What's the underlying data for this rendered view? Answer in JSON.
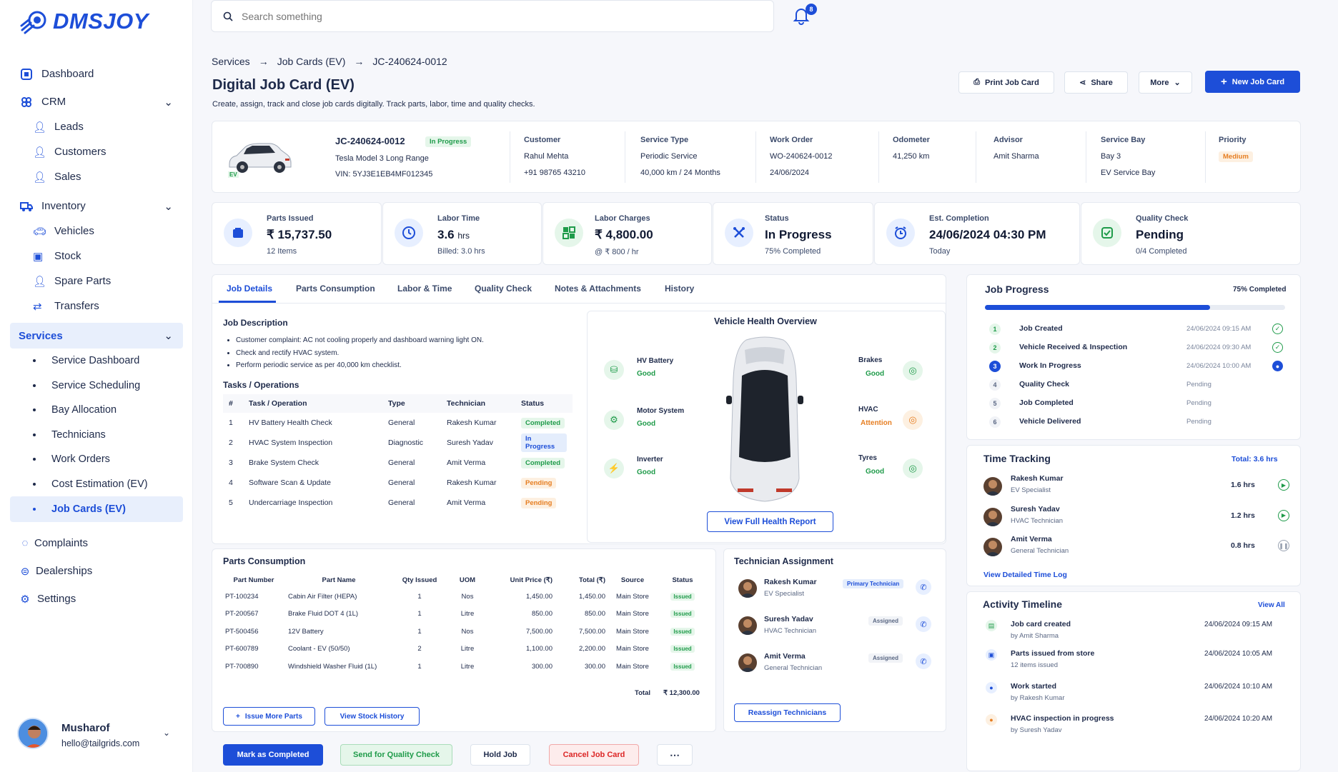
{
  "brand": {
    "name": "DMSJOY"
  },
  "sidebar": {
    "items": {
      "dashboard": "Dashboard",
      "crm": "CRM",
      "leads": "Leads",
      "customers": "Customers",
      "sales": "Sales",
      "inventory": "Inventory",
      "vehicles": "Vehicles",
      "stock": "Stock",
      "spare_parts": "Spare Parts",
      "transfers": "Transfers",
      "services": "Services",
      "service_dashboard": "Service Dashboard",
      "service_scheduling": "Service Scheduling",
      "bay_allocation": "Bay Allocation",
      "technicians": "Technicians",
      "work_orders": "Work Orders",
      "cost_estimation": "Cost Estimation (EV)",
      "job_cards": "Job Cards (EV)",
      "complaints": "Complaints",
      "dealerships": "Dealerships",
      "settings": "Settings"
    }
  },
  "user": {
    "name": "Musharof",
    "email": "hello@tailgrids.com"
  },
  "search": {
    "placeholder": "Search something"
  },
  "notifications": {
    "count": "8"
  },
  "breadcrumb": {
    "a": "Services",
    "b": "Job Cards (EV)",
    "c": "JC-240624-0012"
  },
  "page": {
    "title": "Digital Job Card (EV)",
    "subtitle": "Create, assign, track and close job cards digitally. Track parts, labor, time and quality checks."
  },
  "actions": {
    "print": "Print Job Card",
    "share": "Share",
    "more": "More",
    "new": "New Job Card"
  },
  "job": {
    "id": "JC-240624-0012",
    "status": "In Progress",
    "model": "Tesla Model 3 Long Range",
    "vin": "VIN: 5YJ3E1EB4MF012345",
    "ev_tag": "EV",
    "customer_label": "Customer",
    "customer": "Rahul Mehta",
    "phone": "+91 98765 43210",
    "service_type_label": "Service Type",
    "service_type": "Periodic Service",
    "service_interval": "40,000 km / 24 Months",
    "work_order_label": "Work Order",
    "work_order": "WO-240624-0012",
    "work_order_date": "24/06/2024",
    "odometer_label": "Odometer",
    "odometer": "41,250 km",
    "advisor_label": "Advisor",
    "advisor": "Amit Sharma",
    "bay_label": "Service Bay",
    "bay": "Bay 3",
    "bay_name": "EV Service Bay",
    "priority_label": "Priority",
    "priority": "Medium"
  },
  "stats": [
    {
      "label": "Parts Issued",
      "value": "₹ 15,737.50",
      "sub": "12 Items"
    },
    {
      "label": "Labor Time",
      "value": "3.6",
      "unit": "hrs",
      "sub": "Billed: 3.0 hrs"
    },
    {
      "label": "Labor Charges",
      "value": "₹ 4,800.00",
      "sub": "@ ₹ 800 / hr"
    },
    {
      "label": "Status",
      "value": "In Progress",
      "sub": "75% Completed"
    },
    {
      "label": "Est. Completion",
      "value": "24/06/2024 04:30 PM",
      "sub": "Today"
    },
    {
      "label": "Quality Check",
      "value": "Pending",
      "sub": "0/4 Completed"
    }
  ],
  "tabs": [
    "Job Details",
    "Parts Consumption",
    "Labor & Time",
    "Quality Check",
    "Notes & Attachments",
    "History"
  ],
  "description": {
    "title": "Job Description",
    "lines": [
      "Customer complaint: AC not cooling properly and dashboard warning light ON.",
      "Check and rectify HVAC system.",
      "Perform periodic service as per 40,000 km checklist."
    ]
  },
  "tasks": {
    "title": "Tasks / Operations",
    "headers": [
      "#",
      "Task / Operation",
      "Type",
      "Technician",
      "Status"
    ],
    "rows": [
      [
        "1",
        "HV Battery Health Check",
        "General",
        "Rakesh Kumar",
        "Completed"
      ],
      [
        "2",
        "HVAC System Inspection",
        "Diagnostic",
        "Suresh Yadav",
        "In Progress"
      ],
      [
        "3",
        "Brake System Check",
        "General",
        "Amit Verma",
        "Completed"
      ],
      [
        "4",
        "Software Scan & Update",
        "General",
        "Rakesh Kumar",
        "Pending"
      ],
      [
        "5",
        "Undercarriage Inspection",
        "General",
        "Amit Verma",
        "Pending"
      ]
    ]
  },
  "health": {
    "title": "Vehicle Health Overview",
    "button": "View Full Health Report",
    "items": {
      "hv": {
        "name": "HV Battery",
        "status": "Good"
      },
      "motor": {
        "name": "Motor System",
        "status": "Good"
      },
      "inverter": {
        "name": "Inverter",
        "status": "Good"
      },
      "brakes": {
        "name": "Brakes",
        "status": "Good"
      },
      "hvac": {
        "name": "HVAC",
        "status": "Attention"
      },
      "tyres": {
        "name": "Tyres",
        "status": "Good"
      }
    }
  },
  "progress": {
    "title": "Job Progress",
    "percent_label": "75% Completed",
    "percent": 75,
    "steps": [
      {
        "n": "1",
        "name": "Job Created",
        "time": "24/06/2024 09:15 AM"
      },
      {
        "n": "2",
        "name": "Vehicle Received & Inspection",
        "time": "24/06/2024 09:30 AM"
      },
      {
        "n": "3",
        "name": "Work In Progress",
        "time": "24/06/2024 10:00 AM"
      },
      {
        "n": "4",
        "name": "Quality Check",
        "time": "Pending"
      },
      {
        "n": "5",
        "name": "Job Completed",
        "time": "Pending"
      },
      {
        "n": "6",
        "name": "Vehicle Delivered",
        "time": "Pending"
      }
    ]
  },
  "time_tracking": {
    "title": "Time Tracking",
    "total": "Total: 3.6 hrs",
    "link": "View Detailed Time Log",
    "rows": [
      {
        "name": "Rakesh Kumar",
        "role": "EV Specialist",
        "hrs": "1.6 hrs"
      },
      {
        "name": "Suresh Yadav",
        "role": "HVAC Technician",
        "hrs": "1.2 hrs"
      },
      {
        "name": "Amit Verma",
        "role": "General Technician",
        "hrs": "0.8 hrs"
      }
    ]
  },
  "parts": {
    "title": "Parts Consumption",
    "headers": [
      "Part Number",
      "Part Name",
      "Qty Issued",
      "UOM",
      "Unit Price (₹)",
      "Total (₹)",
      "Source",
      "Status"
    ],
    "rows": [
      [
        "PT-100234",
        "Cabin Air Filter (HEPA)",
        "1",
        "Nos",
        "1,450.00",
        "1,450.00",
        "Main Store",
        "Issued"
      ],
      [
        "PT-200567",
        "Brake Fluid DOT 4 (1L)",
        "1",
        "Litre",
        "850.00",
        "850.00",
        "Main Store",
        "Issued"
      ],
      [
        "PT-500456",
        "12V Battery",
        "1",
        "Nos",
        "7,500.00",
        "7,500.00",
        "Main Store",
        "Issued"
      ],
      [
        "PT-600789",
        "Coolant - EV (50/50)",
        "2",
        "Litre",
        "1,100.00",
        "2,200.00",
        "Main Store",
        "Issued"
      ],
      [
        "PT-700890",
        "Windshield Washer Fluid (1L)",
        "1",
        "Litre",
        "300.00",
        "300.00",
        "Main Store",
        "Issued"
      ]
    ],
    "total_label": "Total",
    "total": "₹ 12,300.00",
    "issue_btn": "Issue More Parts",
    "history_btn": "View Stock History"
  },
  "techs": {
    "title": "Technician Assignment",
    "button": "Reassign Technicians",
    "rows": [
      {
        "name": "Rakesh Kumar",
        "role": "EV Specialist",
        "tag": "Primary Technician"
      },
      {
        "name": "Suresh Yadav",
        "role": "HVAC Technician",
        "tag": "Assigned"
      },
      {
        "name": "Amit Verma",
        "role": "General Technician",
        "tag": "Assigned"
      }
    ]
  },
  "activity": {
    "title": "Activity Timeline",
    "view_all": "View All",
    "rows": [
      {
        "title": "Job card created",
        "sub": "by Amit Sharma",
        "time": "24/06/2024 09:15 AM"
      },
      {
        "title": "Parts issued from store",
        "sub": "12 items issued",
        "time": "24/06/2024 10:05 AM"
      },
      {
        "title": "Work started",
        "sub": "by Rakesh Kumar",
        "time": "24/06/2024 10:10 AM"
      },
      {
        "title": "HVAC inspection in progress",
        "sub": "by Suresh Yadav",
        "time": "24/06/2024 10:20 AM"
      }
    ]
  },
  "footer_actions": {
    "complete": "Mark as Completed",
    "qc": "Send for Quality Check",
    "hold": "Hold Job",
    "cancel": "Cancel Job Card",
    "more": "⋯"
  },
  "colors": {
    "primary": "#1d4ed8",
    "success": "#1f9b4a",
    "warning": "#e67e22",
    "danger": "#dc2626"
  }
}
